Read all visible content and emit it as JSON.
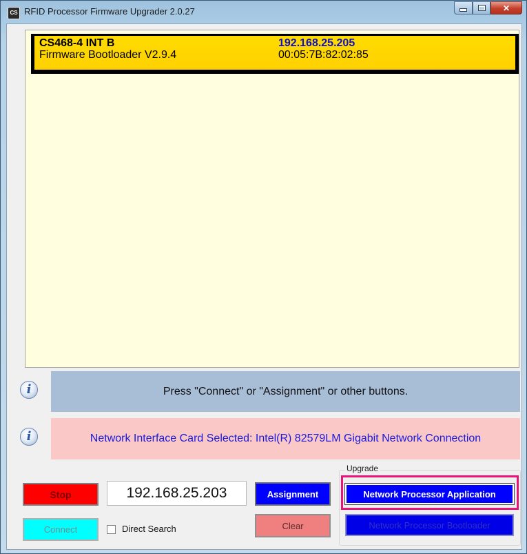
{
  "window": {
    "title": "RFID Processor Firmware Upgrader 2.0.27",
    "icon_text": "CS"
  },
  "device_list": {
    "devices": [
      {
        "model": "CS468-4 INT B",
        "firmware": "Firmware Bootloader V2.9.4",
        "ip": "192.168.25.205",
        "mac": "00:05:7B:82:02:85"
      }
    ]
  },
  "messages": {
    "status": "Press \"Connect\" or \"Assignment\" or other buttons.",
    "nic": "Network Interface Card Selected: Intel(R) 82579LM Gigabit Network Connection"
  },
  "controls": {
    "stop_label": "Stop",
    "connect_label": "Connect",
    "ip_value": "192.168.25.203",
    "assignment_label": "Assignment",
    "clear_label": "Clear",
    "direct_search_label": "Direct Search",
    "direct_search_checked": false
  },
  "upgrade": {
    "group_label": "Upgrade",
    "app_label": "Network Processor Application",
    "bootloader_label": "Network Processor Bootloader"
  },
  "colors": {
    "highlight": "#e8147a",
    "device_card": "#ffd800",
    "list_background": "#ffffe0",
    "status_bar": "#a8bdd6",
    "nic_bar": "#fbc8c8"
  },
  "icons": [
    "info-icon",
    "app-icon",
    "minimize-icon",
    "maximize-icon",
    "close-icon"
  ]
}
